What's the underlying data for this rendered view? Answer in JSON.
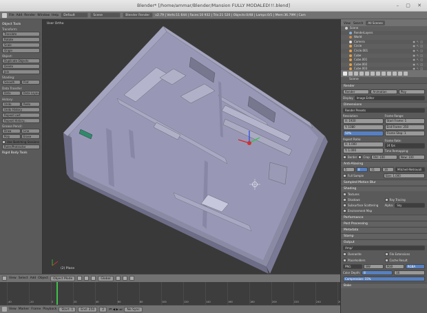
{
  "window": {
    "title": "Blender* [/home/ammar/Blender/Mansion FULLY MODALED!!!.blend]"
  },
  "topbar": {
    "menus": [
      "File",
      "Add",
      "Render",
      "Window",
      "Help"
    ],
    "layout": "Default",
    "scene": "Scene",
    "engine": "Blender Render",
    "stats": "v2.79 | Verts:11 644 | Faces:10 932 | Tris:21 520 | Objects:0/48 | Lamps:0/1 | Mem:36.79M | Cam"
  },
  "toolshelf": {
    "title": "Object Tools",
    "transform": {
      "title": "Transform:",
      "buttons": [
        "Translate",
        "Rotate",
        "Scale",
        "Origin"
      ]
    },
    "object": {
      "title": "Object:",
      "buttons": [
        "Duplicate Objects",
        "Delete",
        "Join"
      ]
    },
    "shading": {
      "title": "Shading:",
      "buttons": [
        "Smooth",
        "Flat"
      ]
    },
    "data_transfer": {
      "title": "Data Transfer:",
      "buttons": [
        "Data",
        "Data Layout"
      ]
    },
    "history": {
      "title": "History:",
      "buttons": [
        "Undo",
        "Redo",
        "Undo History",
        "Repeat Last",
        "Repeat History..."
      ]
    },
    "grease": {
      "title": "Grease Pencil:",
      "buttons": [
        "Draw",
        "Line",
        "Poly",
        "Erase"
      ]
    },
    "stroke": {
      "label": "Use Sketching Sessions",
      "button": "Ruler/Protractor"
    },
    "panel2": "Rigid Body Tools"
  },
  "viewport": {
    "top_label": "User Ortho",
    "bottom_label": "(2) Plane"
  },
  "outliner": {
    "menus": [
      "View",
      "Search"
    ],
    "filter": "All Scenes",
    "items": [
      {
        "label": "Scene",
        "color": "#cfcfcf"
      },
      {
        "label": "RenderLayers",
        "color": "#8ab0d8"
      },
      {
        "label": "World",
        "color": "#cd8b4d"
      },
      {
        "label": "Camera",
        "color": "#ddd"
      },
      {
        "label": "Circle",
        "color": "#e3a04a"
      },
      {
        "label": "Circle.001",
        "color": "#e3a04a"
      },
      {
        "label": "Cube",
        "color": "#e3a04a"
      },
      {
        "label": "Cube.001",
        "color": "#e3a04a"
      },
      {
        "label": "Cube.002",
        "color": "#e3a04a"
      },
      {
        "label": "Cube.003",
        "color": "#e3a04a"
      }
    ]
  },
  "properties": {
    "crumb": "Scene",
    "render_title": "Render",
    "render_buttons": [
      "Render",
      "Animation",
      "Play"
    ],
    "display_label": "Display",
    "display_value": "Image Editor",
    "dimensions_title": "Dimensions",
    "presets": "Render Presets",
    "resolution_label": "Resolution:",
    "res_x": "X: 1920",
    "res_y": "Y: 1080",
    "res_pct": "50%",
    "frame_range_label": "Frame Range:",
    "start_frame": "Start Frame: 1",
    "end_frame": "End Frame: 250",
    "frame_step": "Frame Step: 1",
    "aspect_label": "Aspect Ratio:",
    "aspect_x": "X: 1.000",
    "aspect_y": "Y: 1.000",
    "frame_rate_label": "Frame Rate:",
    "fps": "24 fps",
    "time_remap_label": "Time Remapping:",
    "old": "Old: 100",
    "new": "New: 100",
    "border": "Border",
    "crop": "Crop",
    "aa_title": "Anti-Aliasing",
    "aa_values": [
      "5",
      "8",
      "11",
      "16"
    ],
    "aa_filter": "Mitchell-Netravali",
    "full_sample": "Full Sample",
    "aa_size": "Size: 1.000",
    "motion_blur": "Sampled Motion Blur",
    "shading_title": "Shading",
    "shading_left": [
      "Textures",
      "Shadows",
      "Subsurface Scattering",
      "Environment Map"
    ],
    "ray_tracing": "Ray Tracing",
    "alpha_label": "Alpha:",
    "alpha_value": "Sky",
    "perf": "Performance",
    "post": "Post Processing",
    "metadata": "Metadata",
    "stamp": "Stamp",
    "output_title": "Output",
    "output_path": "/tmp/",
    "overwrite": "Overwrite",
    "file_ext": "File Extensions",
    "placeholders": "Placeholders",
    "cache_result": "Cache Result",
    "format": "PNG",
    "color_modes": [
      "BW",
      "RGB",
      "RGBA"
    ],
    "color_depth_label": "Color Depth:",
    "depth_values": [
      "8",
      "16"
    ],
    "compression": "Compression: 15%",
    "bake": "Bake"
  },
  "vp_header": {
    "menus": [
      "View",
      "Select",
      "Add",
      "Object"
    ],
    "mode": "Object Mode",
    "pivot": "Global"
  },
  "timeline": {
    "ticks": [
      "-40",
      "-20",
      "0",
      "20",
      "40",
      "60",
      "80",
      "100",
      "120",
      "140",
      "160",
      "180",
      "200",
      "220",
      "240",
      "260"
    ]
  },
  "tl_header": {
    "menus": [
      "View",
      "Marker",
      "Frame",
      "Playback"
    ],
    "start": "Start: 1",
    "end": "End: 250",
    "current": "2",
    "sync": "No Sync"
  }
}
